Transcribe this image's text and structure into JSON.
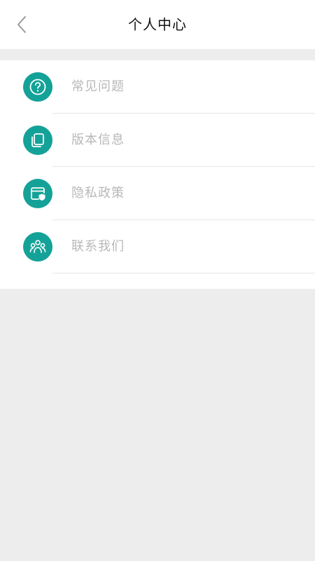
{
  "header": {
    "title": "个人中心",
    "back_icon": "chevron-left-icon"
  },
  "menu": {
    "items": [
      {
        "label": "常见问题",
        "icon": "question-circle-icon"
      },
      {
        "label": "版本信息",
        "icon": "stacked-pages-icon"
      },
      {
        "label": "隐私政策",
        "icon": "shield-window-icon"
      },
      {
        "label": "联系我们",
        "icon": "contacts-group-icon"
      }
    ]
  },
  "colors": {
    "accent": "#14a298",
    "label_text": "#b8b8b8",
    "page_background": "#ededed",
    "card_background": "#ffffff"
  }
}
